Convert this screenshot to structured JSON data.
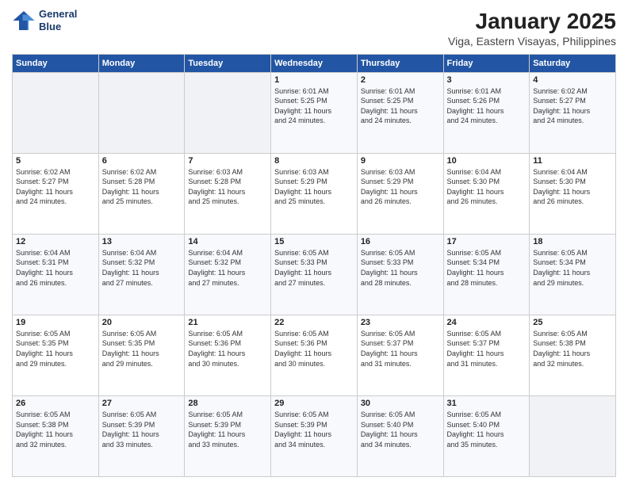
{
  "logo": {
    "line1": "General",
    "line2": "Blue"
  },
  "title": "January 2025",
  "subtitle": "Viga, Eastern Visayas, Philippines",
  "weekdays": [
    "Sunday",
    "Monday",
    "Tuesday",
    "Wednesday",
    "Thursday",
    "Friday",
    "Saturday"
  ],
  "weeks": [
    [
      {
        "day": "",
        "info": ""
      },
      {
        "day": "",
        "info": ""
      },
      {
        "day": "",
        "info": ""
      },
      {
        "day": "1",
        "info": "Sunrise: 6:01 AM\nSunset: 5:25 PM\nDaylight: 11 hours\nand 24 minutes."
      },
      {
        "day": "2",
        "info": "Sunrise: 6:01 AM\nSunset: 5:25 PM\nDaylight: 11 hours\nand 24 minutes."
      },
      {
        "day": "3",
        "info": "Sunrise: 6:01 AM\nSunset: 5:26 PM\nDaylight: 11 hours\nand 24 minutes."
      },
      {
        "day": "4",
        "info": "Sunrise: 6:02 AM\nSunset: 5:27 PM\nDaylight: 11 hours\nand 24 minutes."
      }
    ],
    [
      {
        "day": "5",
        "info": "Sunrise: 6:02 AM\nSunset: 5:27 PM\nDaylight: 11 hours\nand 24 minutes."
      },
      {
        "day": "6",
        "info": "Sunrise: 6:02 AM\nSunset: 5:28 PM\nDaylight: 11 hours\nand 25 minutes."
      },
      {
        "day": "7",
        "info": "Sunrise: 6:03 AM\nSunset: 5:28 PM\nDaylight: 11 hours\nand 25 minutes."
      },
      {
        "day": "8",
        "info": "Sunrise: 6:03 AM\nSunset: 5:29 PM\nDaylight: 11 hours\nand 25 minutes."
      },
      {
        "day": "9",
        "info": "Sunrise: 6:03 AM\nSunset: 5:29 PM\nDaylight: 11 hours\nand 26 minutes."
      },
      {
        "day": "10",
        "info": "Sunrise: 6:04 AM\nSunset: 5:30 PM\nDaylight: 11 hours\nand 26 minutes."
      },
      {
        "day": "11",
        "info": "Sunrise: 6:04 AM\nSunset: 5:30 PM\nDaylight: 11 hours\nand 26 minutes."
      }
    ],
    [
      {
        "day": "12",
        "info": "Sunrise: 6:04 AM\nSunset: 5:31 PM\nDaylight: 11 hours\nand 26 minutes."
      },
      {
        "day": "13",
        "info": "Sunrise: 6:04 AM\nSunset: 5:32 PM\nDaylight: 11 hours\nand 27 minutes."
      },
      {
        "day": "14",
        "info": "Sunrise: 6:04 AM\nSunset: 5:32 PM\nDaylight: 11 hours\nand 27 minutes."
      },
      {
        "day": "15",
        "info": "Sunrise: 6:05 AM\nSunset: 5:33 PM\nDaylight: 11 hours\nand 27 minutes."
      },
      {
        "day": "16",
        "info": "Sunrise: 6:05 AM\nSunset: 5:33 PM\nDaylight: 11 hours\nand 28 minutes."
      },
      {
        "day": "17",
        "info": "Sunrise: 6:05 AM\nSunset: 5:34 PM\nDaylight: 11 hours\nand 28 minutes."
      },
      {
        "day": "18",
        "info": "Sunrise: 6:05 AM\nSunset: 5:34 PM\nDaylight: 11 hours\nand 29 minutes."
      }
    ],
    [
      {
        "day": "19",
        "info": "Sunrise: 6:05 AM\nSunset: 5:35 PM\nDaylight: 11 hours\nand 29 minutes."
      },
      {
        "day": "20",
        "info": "Sunrise: 6:05 AM\nSunset: 5:35 PM\nDaylight: 11 hours\nand 29 minutes."
      },
      {
        "day": "21",
        "info": "Sunrise: 6:05 AM\nSunset: 5:36 PM\nDaylight: 11 hours\nand 30 minutes."
      },
      {
        "day": "22",
        "info": "Sunrise: 6:05 AM\nSunset: 5:36 PM\nDaylight: 11 hours\nand 30 minutes."
      },
      {
        "day": "23",
        "info": "Sunrise: 6:05 AM\nSunset: 5:37 PM\nDaylight: 11 hours\nand 31 minutes."
      },
      {
        "day": "24",
        "info": "Sunrise: 6:05 AM\nSunset: 5:37 PM\nDaylight: 11 hours\nand 31 minutes."
      },
      {
        "day": "25",
        "info": "Sunrise: 6:05 AM\nSunset: 5:38 PM\nDaylight: 11 hours\nand 32 minutes."
      }
    ],
    [
      {
        "day": "26",
        "info": "Sunrise: 6:05 AM\nSunset: 5:38 PM\nDaylight: 11 hours\nand 32 minutes."
      },
      {
        "day": "27",
        "info": "Sunrise: 6:05 AM\nSunset: 5:39 PM\nDaylight: 11 hours\nand 33 minutes."
      },
      {
        "day": "28",
        "info": "Sunrise: 6:05 AM\nSunset: 5:39 PM\nDaylight: 11 hours\nand 33 minutes."
      },
      {
        "day": "29",
        "info": "Sunrise: 6:05 AM\nSunset: 5:39 PM\nDaylight: 11 hours\nand 34 minutes."
      },
      {
        "day": "30",
        "info": "Sunrise: 6:05 AM\nSunset: 5:40 PM\nDaylight: 11 hours\nand 34 minutes."
      },
      {
        "day": "31",
        "info": "Sunrise: 6:05 AM\nSunset: 5:40 PM\nDaylight: 11 hours\nand 35 minutes."
      },
      {
        "day": "",
        "info": ""
      }
    ]
  ]
}
